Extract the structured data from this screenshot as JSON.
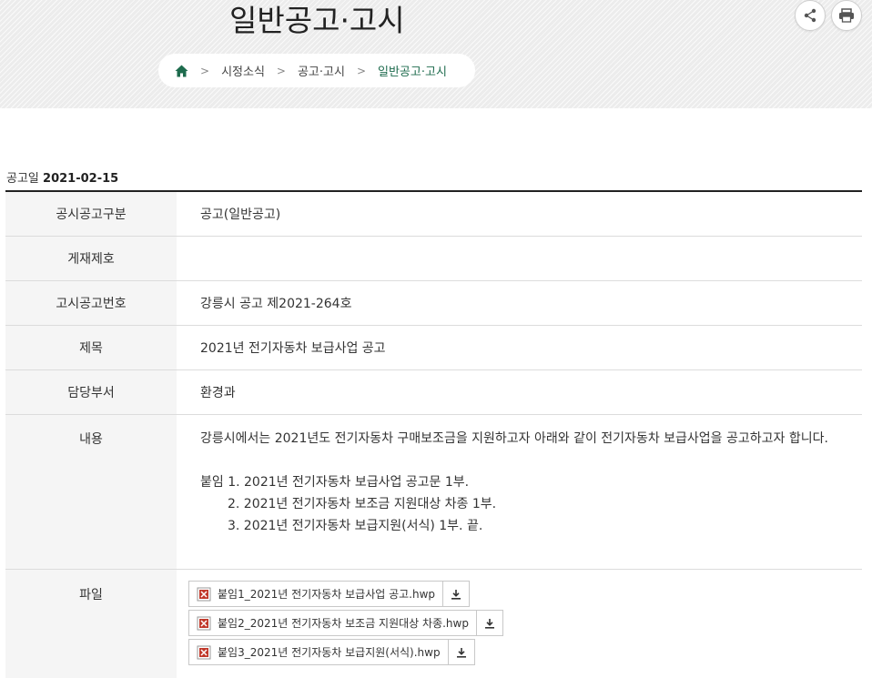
{
  "header": {
    "title": "일반공고·고시",
    "icons": {
      "share": "share-icon",
      "print": "print-icon",
      "home": "home-icon"
    }
  },
  "breadcrumb": {
    "items": [
      "시정소식",
      "공고·고시",
      "일반공고·고시"
    ],
    "separator": ">"
  },
  "notice": {
    "date_label": "공고일",
    "date_value": "2021-02-15"
  },
  "table": {
    "rows": [
      {
        "label": "공시공고구분",
        "value": "공고(일반공고)"
      },
      {
        "label": "게재제호",
        "value": ""
      },
      {
        "label": "고시공고번호",
        "value": "강릉시 공고 제2021-264호"
      },
      {
        "label": "제목",
        "value": "2021년 전기자동차 보급사업 공고"
      },
      {
        "label": "담당부서",
        "value": "환경과"
      }
    ],
    "content_label": "내용",
    "content_paragraph": "강릉시에서는 2021년도 전기자동차 구매보조금을 지원하고자 아래와 같이 전기자동차 보급사업을 공고하고자 합니다.",
    "attachments_text": [
      "붙임 1. 2021년 전기자동차 보급사업 공고문 1부.",
      "2. 2021년 전기자동차 보조금 지원대상 차종 1부.",
      "3. 2021년 전기자동차 보급지원(서식) 1부.   끝."
    ],
    "files_label": "파일",
    "files": [
      "붙임1_2021년 전기자동차 보급사업 공고.hwp",
      "붙임2_2021년 전기자동차 보조금 지원대상 차종.hwp",
      "붙임3_2021년 전기자동차 보급지원(서식).hwp"
    ]
  },
  "colors": {
    "accent_green": "#1d6b4d",
    "file_icon_red": "#c0392b",
    "table_header_bg": "#f5f5f5"
  }
}
